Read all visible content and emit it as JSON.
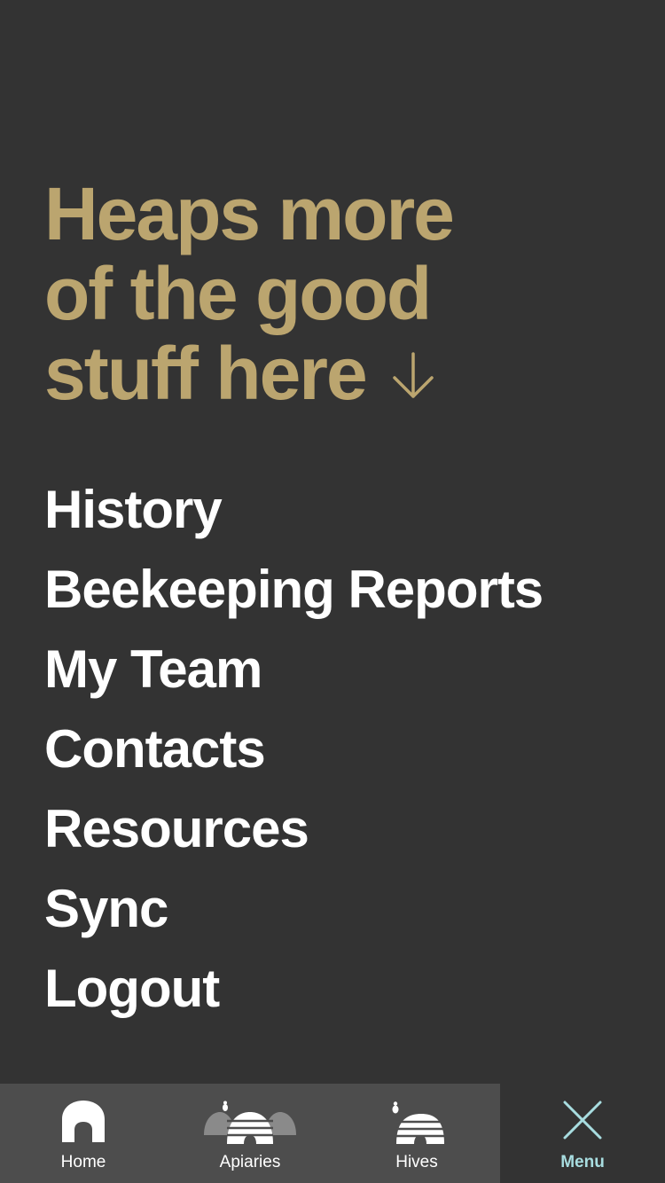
{
  "headline": {
    "line1": "Heaps more",
    "line2": "of the good",
    "line3": "stuff here"
  },
  "menu": {
    "items": [
      {
        "label": "History"
      },
      {
        "label": "Beekeeping Reports"
      },
      {
        "label": "My Team"
      },
      {
        "label": "Contacts"
      },
      {
        "label": "Resources"
      },
      {
        "label": "Sync"
      },
      {
        "label": "Logout"
      }
    ]
  },
  "tabbar": {
    "tabs": [
      {
        "label": "Home",
        "icon": "home-icon",
        "active": false
      },
      {
        "label": "Apiaries",
        "icon": "apiaries-icon",
        "active": false
      },
      {
        "label": "Hives",
        "icon": "hive-icon",
        "active": false
      },
      {
        "label": "Menu",
        "icon": "close-icon",
        "active": true
      }
    ]
  },
  "colors": {
    "background": "#333333",
    "headline": "#BBA56F",
    "menu_text": "#FFFFFF",
    "tabbar_bg": "#4D4D4D",
    "active_tab_accent": "#A8DDE0"
  }
}
